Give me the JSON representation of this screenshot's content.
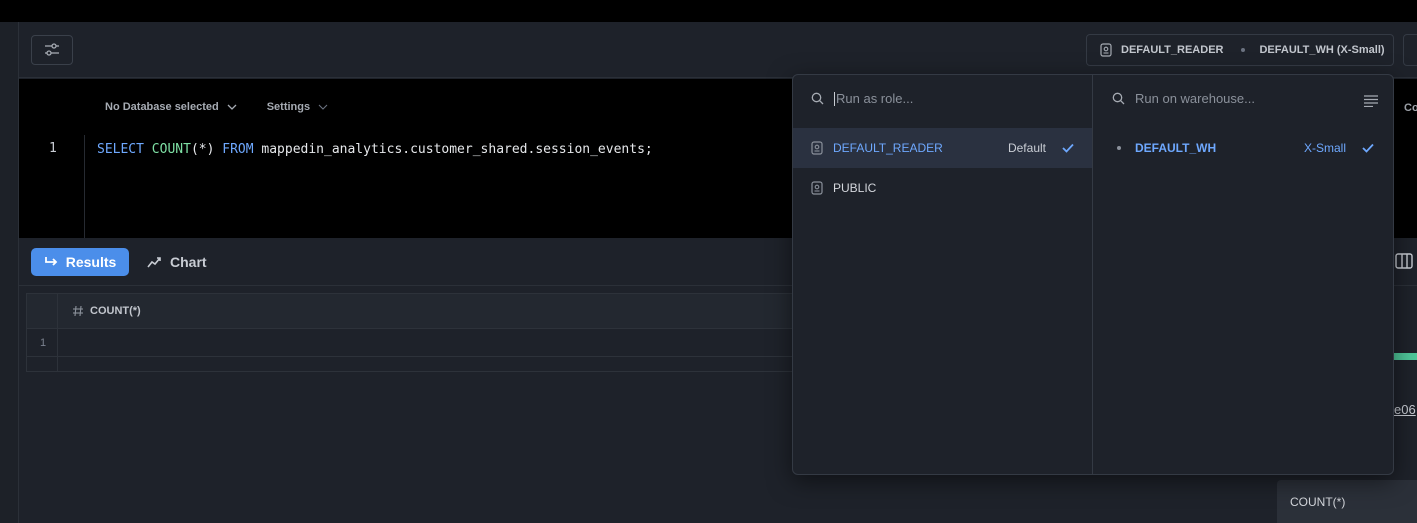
{
  "toolbar": {
    "role": "DEFAULT_READER",
    "warehouse": "DEFAULT_WH (X-Small)"
  },
  "editor": {
    "database_selector": "No Database selected",
    "settings_label": "Settings",
    "line_number": "1",
    "code": {
      "kw_select": "SELECT",
      "fn_count": "COUNT",
      "paren": "(*)",
      "kw_from": "FROM",
      "table": "mappedin_analytics.customer_shared.session_events;"
    }
  },
  "results": {
    "results_tab": "Results",
    "chart_tab": "Chart",
    "column_header": "COUNT(*)",
    "row_number": "1"
  },
  "side": {
    "link_fragment": "e06",
    "card_label": "COUNT(*)",
    "header_fragment": "Co"
  },
  "dropdown": {
    "role_search_placeholder": "Run as role...",
    "warehouse_search_placeholder": "Run on warehouse...",
    "roles": [
      {
        "name": "DEFAULT_READER",
        "tag": "Default",
        "selected": true
      },
      {
        "name": "PUBLIC",
        "tag": "",
        "selected": false
      }
    ],
    "warehouses": [
      {
        "name": "DEFAULT_WH",
        "size": "X-Small",
        "selected": true
      }
    ]
  },
  "colors": {
    "accent": "#4b8eea",
    "accent_text": "#6ea8fe",
    "keyword": "#6ea8fe",
    "function": "#7ee0a4",
    "status_green": "#4fc79a"
  }
}
